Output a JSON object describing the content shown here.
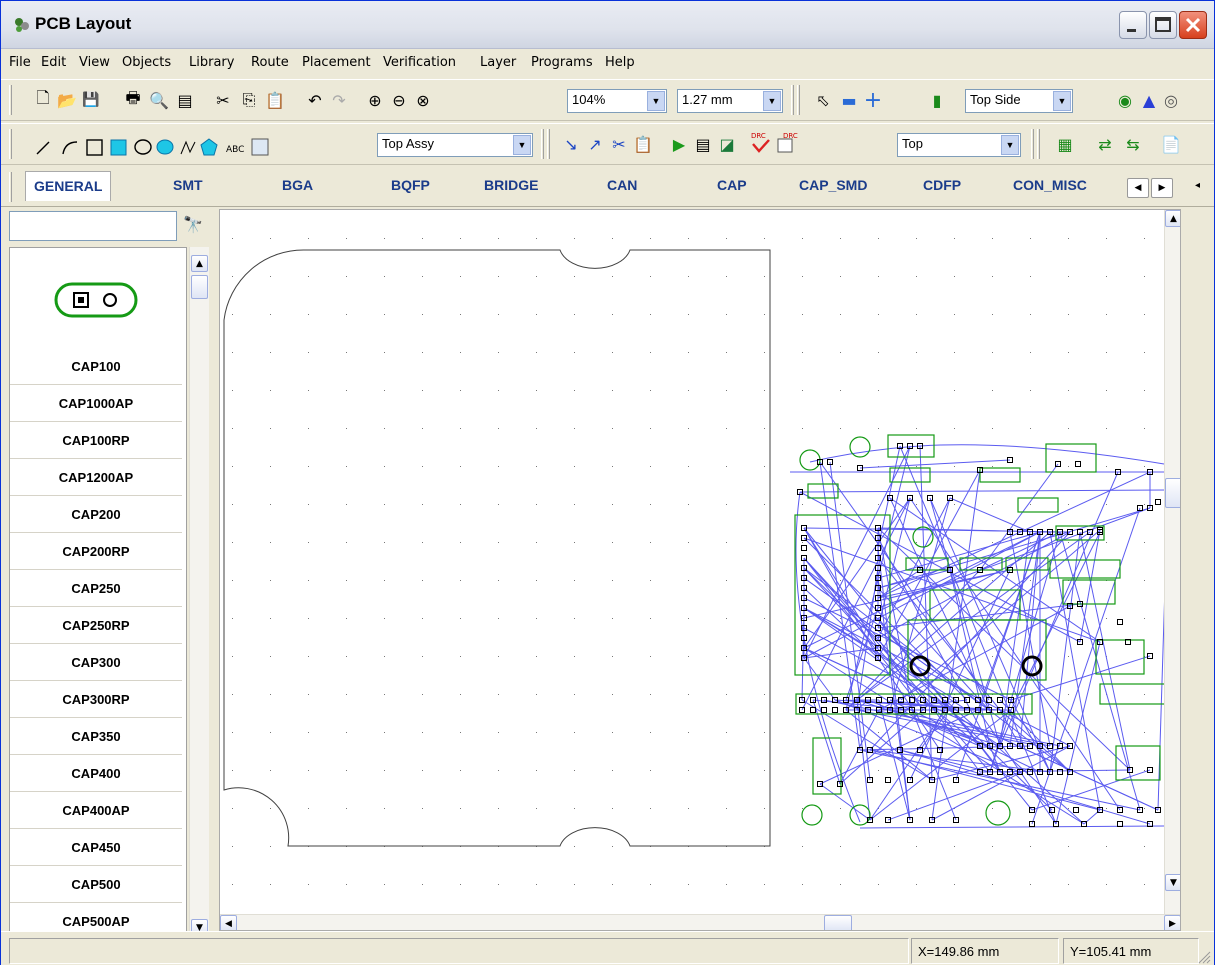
{
  "window": {
    "title": "PCB Layout"
  },
  "menu": [
    "File",
    "Edit",
    "View",
    "Objects",
    "Library",
    "Route",
    "Placement",
    "Verification",
    "Layer",
    "Programs",
    "Help"
  ],
  "toolbar": {
    "zoom": "104%",
    "grid": "1.27 mm",
    "side": "Top Side",
    "text_tool_label": "ABC",
    "assy_layer": "Top Assy",
    "layer": "Top",
    "drc_label": "DRC",
    "drc2_label": "DRC"
  },
  "library_tabs": [
    "GENERAL",
    "SMT",
    "BGA",
    "BQFP",
    "BRIDGE",
    "CAN",
    "CAP",
    "CAP_SMD",
    "CDFP",
    "CON_MISC"
  ],
  "active_tab": "GENERAL",
  "components": [
    "CAP100",
    "CAP1000AP",
    "CAP100RP",
    "CAP1200AP",
    "CAP200",
    "CAP200RP",
    "CAP250",
    "CAP250RP",
    "CAP300",
    "CAP300RP",
    "CAP350",
    "CAP400",
    "CAP400AP",
    "CAP450",
    "CAP500",
    "CAP500AP"
  ],
  "status": {
    "x": "X=149.86 mm",
    "y": "Y=105.41 mm"
  },
  "colors": {
    "accent": "#1b3c8a",
    "rats": "#5b5bf0",
    "footprint": "#159a15",
    "board": "#000000"
  }
}
